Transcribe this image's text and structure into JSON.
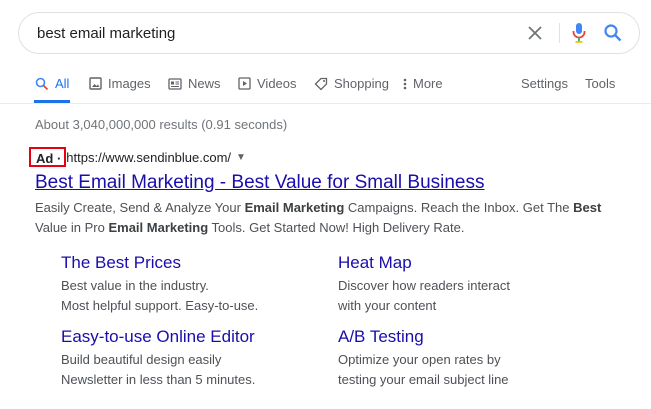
{
  "search": {
    "query": "best email marketing",
    "icons": {
      "clear": "close-icon",
      "voice": "mic-icon",
      "submit": "search-icon"
    }
  },
  "tabs": [
    {
      "label": "All",
      "icon": "search-icon",
      "active": true
    },
    {
      "label": "Images",
      "icon": "image-icon"
    },
    {
      "label": "News",
      "icon": "news-icon"
    },
    {
      "label": "Videos",
      "icon": "play-icon"
    },
    {
      "label": "Shopping",
      "icon": "tag-icon"
    },
    {
      "label": "More",
      "icon": "more-vertical-icon"
    },
    {
      "label": "Settings"
    },
    {
      "label": "Tools"
    }
  ],
  "stats": "About 3,040,000,000 results (0.91 seconds)",
  "ad": {
    "badge": "Ad ·",
    "url": "https://www.sendinblue.com/",
    "title": "Best Email Marketing - Best Value for Small Business",
    "description": [
      {
        "text": "Easily Create, Send & Analyze Your ",
        "bold": false
      },
      {
        "text": "Email Marketing",
        "bold": true
      },
      {
        "text": " Campaigns. Reach the Inbox. Get The ",
        "bold": false
      },
      {
        "text": "Best",
        "bold": true
      },
      {
        "text": " Value in Pro ",
        "bold": false
      },
      {
        "text": "Email Marketing",
        "bold": true
      },
      {
        "text": " Tools. Get Started Now! High Delivery Rate.",
        "bold": false
      }
    ],
    "badge_border_color": "#e8000e"
  },
  "sitelinks": [
    {
      "title": "The Best Prices",
      "line1": "Best value in the industry.",
      "line2": "Most helpful support. Easy-to-use."
    },
    {
      "title": "Heat Map",
      "line1": "Discover how readers interact",
      "line2": "with your content"
    },
    {
      "title": "Easy-to-use Online Editor",
      "line1": "Build beautiful design easily",
      "line2": "Newsletter in less than 5 minutes."
    },
    {
      "title": "A/B Testing",
      "line1": "Optimize your open rates by",
      "line2": "testing your email subject line"
    }
  ],
  "colors": {
    "link": "#1a0dab",
    "accent": "#1a73e8",
    "mic_red": "#ea4335",
    "mic_blue": "#4285f4",
    "mic_green": "#34a853",
    "mic_yellow": "#fbbc05"
  }
}
